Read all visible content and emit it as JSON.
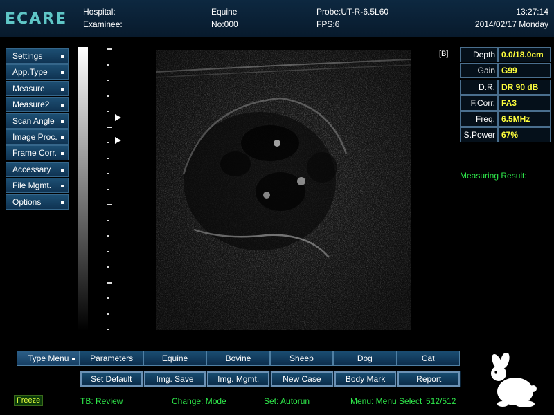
{
  "header": {
    "logo": "ECARE",
    "hospital_label": "Hospital:",
    "examinee_label": "Examinee:",
    "species": "Equine",
    "number": "No:000",
    "probe": "Probe:UT-R-6.5L60",
    "fps": "FPS:6",
    "time": "13:27:14",
    "date": "2014/02/17 Monday"
  },
  "left_menu": {
    "items": [
      {
        "label": "Settings"
      },
      {
        "label": "App.Type"
      },
      {
        "label": "Measure"
      },
      {
        "label": "Measure2"
      },
      {
        "label": "Scan Angle"
      },
      {
        "label": "Image Proc."
      },
      {
        "label": "Frame Corr."
      },
      {
        "label": "Accessary"
      },
      {
        "label": "File Mgmt."
      },
      {
        "label": "Options"
      }
    ]
  },
  "image": {
    "mode_marker": "[B]"
  },
  "params": {
    "rows": [
      {
        "label": "Depth",
        "value": "0.0/18.0cm"
      },
      {
        "label": "Gain",
        "value": "G99"
      },
      {
        "label": "D.R.",
        "value": "DR 90 dB"
      },
      {
        "label": "F.Corr.",
        "value": "FA3"
      },
      {
        "label": "Freq.",
        "value": "6.5MHz"
      },
      {
        "label": "S.Power",
        "value": "67%"
      }
    ],
    "measuring_result": "Measuring Result:"
  },
  "type_menu": {
    "items": [
      "Type Menu",
      "Parameters",
      "Equine",
      "Bovine",
      "Sheep",
      "Dog",
      "Cat"
    ]
  },
  "buttons": {
    "items": [
      "Set Default",
      "Img. Save",
      "Img. Mgmt.",
      "New Case",
      "Body Mark",
      "Report"
    ]
  },
  "status": {
    "freeze": "Freeze",
    "tb": "TB: Review",
    "change": "Change: Mode",
    "set": "Set: Autorun",
    "menu": "Menu: Menu Select",
    "frames": "512/512"
  },
  "colors": {
    "accent_value": "#ffff3c",
    "status_green": "#2ee84a",
    "header_bg": "#0d2840",
    "button_bg": "#184c70"
  },
  "icons": {
    "body_mark": "rabbit-icon"
  }
}
